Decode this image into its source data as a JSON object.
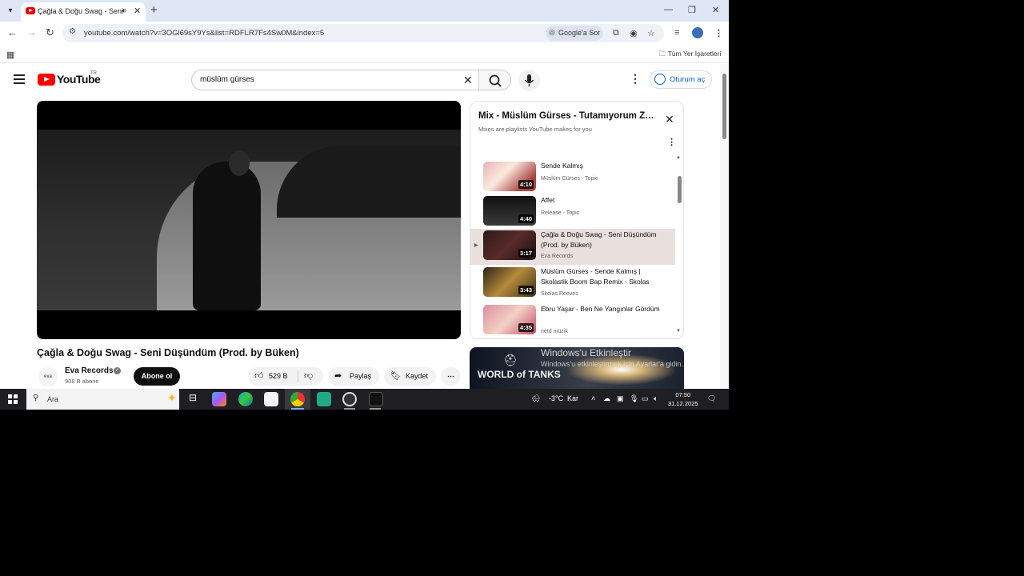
{
  "browser": {
    "tab_title": "Çağla & Doğu Swag - Seni",
    "tab_audio_icon": "speaker-icon",
    "url": "youtube.com/watch?v=3OGl69sY9Ys&list=RDFLR7Fs4Sw0M&index=5",
    "google_ask": "Google'a Sor",
    "all_bookmarks": "Tüm Yer İşaretleri"
  },
  "youtube": {
    "logo_text": "YouTube",
    "country": "TR",
    "search_query": "müslüm gürses",
    "sign_in": "Oturum aç",
    "video": {
      "title": "Çağla & Doğu Swag - Seni Düşündüm (Prod. by Büken)",
      "channel": "Eva Records",
      "channel_avatar_text": "eva",
      "subscribers": "908 B abone",
      "subscribe": "Abone ol",
      "likes": "529 B",
      "share": "Paylaş",
      "save": "Kaydet"
    },
    "playlist": {
      "title": "Mix - Müslüm Gürses - Tutamıyorum Zamanı",
      "subtitle": "Mixes are playlists YouTube makes for you",
      "items": [
        {
          "title": "Sende Kalmış",
          "channel": "Müslüm Gürses - Topic",
          "duration": "4:10",
          "active": false
        },
        {
          "title": "Affet",
          "channel": "Release - Topic",
          "duration": "4:40",
          "active": false
        },
        {
          "title": "Çağla & Doğu Swag - Seni Düşündüm (Prod. by Büken)",
          "channel": "Eva Records",
          "duration": "3:17",
          "active": true
        },
        {
          "title": "Müslüm Gürses - Sende Kalmış | Skolastik Boom Bap Remix - Skolas Reeves",
          "channel": "Skolas Reeves",
          "duration": "3:43",
          "active": false
        },
        {
          "title": "Ebru Yaşar - Ben Ne Yangınlar Gördüm",
          "channel": "netd müzik",
          "duration": "4:35",
          "active": false
        }
      ]
    },
    "ad": {
      "brand": "WORLD of TANKS"
    },
    "activation": {
      "title": "Windows'u Etkinleştir",
      "subtitle": "Windows'u etkinleştirmek için Ayarlar'a gidin."
    }
  },
  "taskbar": {
    "search_placeholder": "Ara",
    "weather": "-3°C",
    "weather_text": "Kar",
    "time": "07:50",
    "date": "31.12.2025"
  }
}
